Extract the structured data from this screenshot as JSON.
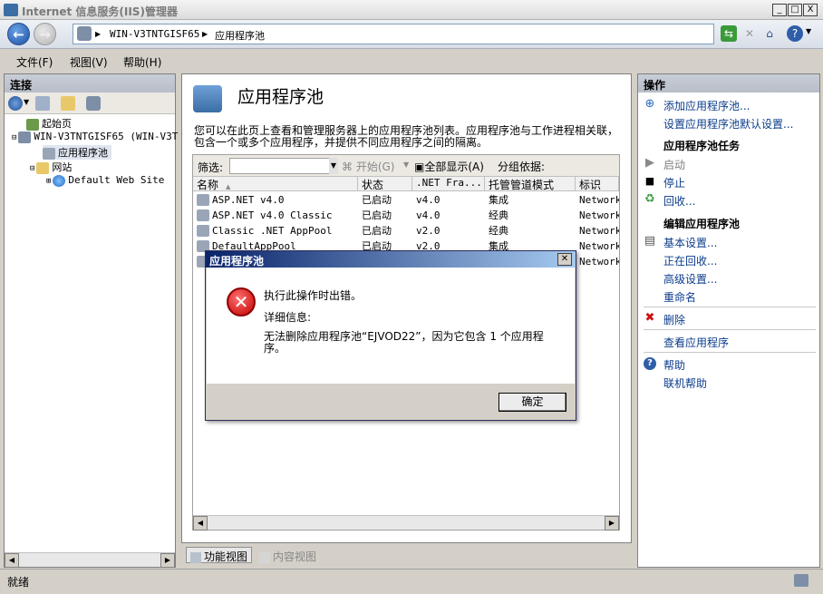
{
  "window": {
    "title": "Internet 信息服务(IIS)管理器",
    "minimize": "_",
    "maximize": "□",
    "close": "X"
  },
  "address": {
    "node": "WIN-V3TNTGISF65",
    "page": "应用程序池",
    "sep": "▶"
  },
  "menu": [
    "文件(F)",
    "视图(V)",
    "帮助(H)"
  ],
  "connections": {
    "header": "连接",
    "tree": [
      {
        "label": "起始页",
        "icon": "start-page-icon"
      },
      {
        "label": "WIN-V3TNTGISF65 (WIN-V3T",
        "icon": "server-icon"
      },
      {
        "label": "应用程序池",
        "icon": "app-pool-icon"
      },
      {
        "label": "网站",
        "icon": "sites-folder-icon"
      },
      {
        "label": "Default Web Site",
        "icon": "globe-icon"
      }
    ]
  },
  "center": {
    "title": "应用程序池",
    "description": "您可以在此页上查看和管理服务器上的应用程序池列表。应用程序池与工作进程相关联，包含一个或多个应用程序，并提供不同应用程序之间的隔离。",
    "filter_label": "筛选:",
    "start_label": "开始(G)",
    "show_all_label": "全部显示(A)",
    "group_label": "分组依据:",
    "columns": [
      "名称",
      "状态",
      ".NET Fra...",
      "托管管道模式",
      "标识"
    ],
    "rows": [
      {
        "name": "ASP.NET v4.0",
        "status": "已启动",
        "framework": "v4.0",
        "mode": "集成",
        "identity": "Network"
      },
      {
        "name": "ASP.NET v4.0 Classic",
        "status": "已启动",
        "framework": "v4.0",
        "mode": "经典",
        "identity": "Network"
      },
      {
        "name": "Classic .NET AppPool",
        "status": "已启动",
        "framework": "v2.0",
        "mode": "经典",
        "identity": "Network"
      },
      {
        "name": "DefaultAppPool",
        "status": "已启动",
        "framework": "v2.0",
        "mode": "集成",
        "identity": "Network"
      },
      {
        "name": "",
        "status": "",
        "framework": "",
        "mode": "",
        "identity": "Network"
      }
    ],
    "features_view": "功能视图",
    "content_view": "内容视图"
  },
  "actions": {
    "header": "操作",
    "add_pool": "添加应用程序池...",
    "set_defaults": "设置应用程序池默认设置...",
    "tasks_header": "应用程序池任务",
    "start": "启动",
    "stop": "停止",
    "recycle": "回收...",
    "edit_header": "编辑应用程序池",
    "basic_settings": "基本设置...",
    "recycling": "正在回收...",
    "advanced_settings": "高级设置...",
    "rename": "重命名",
    "delete": "删除",
    "view_apps": "查看应用程序",
    "help": "帮助",
    "online_help": "联机帮助"
  },
  "dialog": {
    "title": "应用程序池",
    "message": "执行此操作时出错。",
    "details_label": "详细信息:",
    "details": "无法删除应用程序池“EJVOD22”，因为它包含 1 个应用程序。",
    "ok": "确定"
  },
  "status": {
    "text": "就绪"
  }
}
